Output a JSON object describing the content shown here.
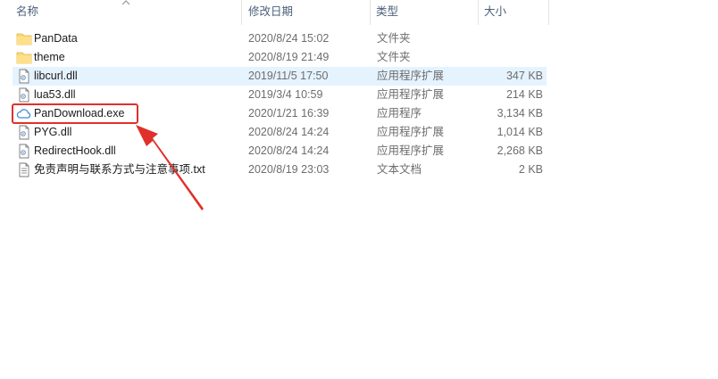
{
  "columns": {
    "name": "名称",
    "date": "修改日期",
    "type": "类型",
    "size": "大小"
  },
  "files": [
    {
      "icon": "folder-icon",
      "name": "PanData",
      "date": "2020/8/24 15:02",
      "type": "文件夹",
      "size": ""
    },
    {
      "icon": "folder-icon",
      "name": "theme",
      "date": "2020/8/19 21:49",
      "type": "文件夹",
      "size": ""
    },
    {
      "icon": "dll-file-icon",
      "name": "libcurl.dll",
      "date": "2019/11/5 17:50",
      "type": "应用程序扩展",
      "size": "347 KB"
    },
    {
      "icon": "dll-file-icon",
      "name": "lua53.dll",
      "date": "2019/3/4 10:59",
      "type": "应用程序扩展",
      "size": "214 KB"
    },
    {
      "icon": "cloud-app-icon",
      "name": "PanDownload.exe",
      "date": "2020/1/21 16:39",
      "type": "应用程序",
      "size": "3,134 KB"
    },
    {
      "icon": "dll-file-icon",
      "name": "PYG.dll",
      "date": "2020/8/24 14:24",
      "type": "应用程序扩展",
      "size": "1,014 KB"
    },
    {
      "icon": "dll-file-icon",
      "name": "RedirectHook.dll",
      "date": "2020/8/24 14:24",
      "type": "应用程序扩展",
      "size": "2,268 KB"
    },
    {
      "icon": "text-file-icon",
      "name": "免责声明与联系方式与注意事项.txt",
      "date": "2020/8/19 23:03",
      "type": "文本文档",
      "size": "2 KB"
    }
  ],
  "colors": {
    "header_text": "#4c607a",
    "selected_row": "#e5f3ff",
    "annotation_red": "#e0302b",
    "folder_yellow": "#f8d775"
  }
}
